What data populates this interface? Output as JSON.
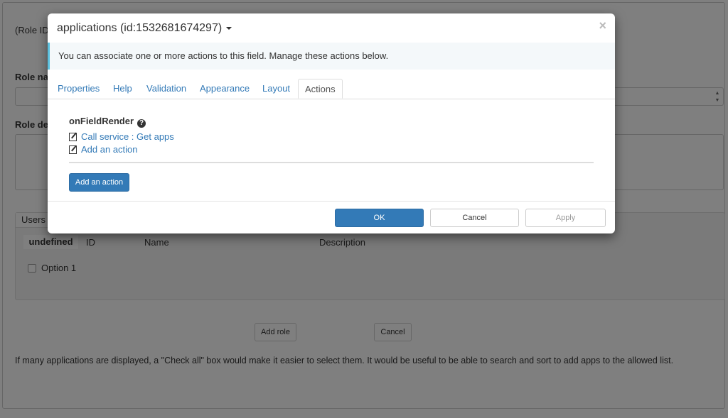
{
  "background": {
    "role_id_label": "(Role ID",
    "role_name_label": "Role na",
    "role_desc_label": "Role de",
    "users_tab_label": "Users a",
    "table_headers": {
      "undefined": "undefined",
      "id": "ID",
      "name": "Name",
      "description": "Description"
    },
    "option_label": "Option 1",
    "add_role_label": "Add role",
    "cancel_label": "Cancel",
    "note": "If many applications are displayed, a \"Check all\" box would make it easier to select them. It would be useful to be able to search and sort to add apps to the allowed list."
  },
  "modal": {
    "title": "applications (id:1532681674297)",
    "close": "×",
    "info": "You can associate one or more actions to this field. Manage these actions below.",
    "tabs": [
      {
        "label": "Properties"
      },
      {
        "label": "Help"
      },
      {
        "label": "Validation"
      },
      {
        "label": "Appearance"
      },
      {
        "label": "Layout"
      },
      {
        "label": "Actions"
      }
    ],
    "event_title": "onFieldRender",
    "help_glyph": "?",
    "actions": [
      {
        "label": "Call service : Get apps"
      },
      {
        "label": "Add an action"
      }
    ],
    "add_button": "Add an action",
    "footer": {
      "ok": "OK",
      "cancel": "Cancel",
      "apply": "Apply"
    }
  }
}
